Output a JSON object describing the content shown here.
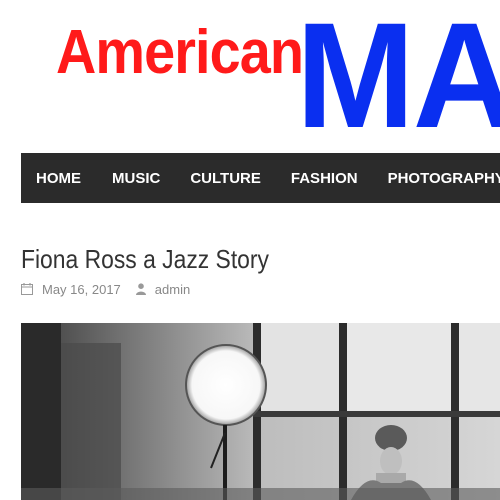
{
  "header": {
    "logo_part1": "American",
    "logo_part2": "MAG",
    "logo_part1_color": "#ff1a1a",
    "logo_part2_color": "#0a2ff0"
  },
  "nav": {
    "background": "#2b2b2b",
    "items": [
      {
        "label": "HOME"
      },
      {
        "label": "MUSIC"
      },
      {
        "label": "CULTURE"
      },
      {
        "label": "FASHION"
      },
      {
        "label": "PHOTOGRAPHY"
      }
    ]
  },
  "post": {
    "title": "Fiona Ross a Jazz Story",
    "date": "May 16, 2017",
    "author": "admin",
    "date_icon": "calendar-icon",
    "author_icon": "user-icon"
  },
  "featured_image": {
    "style": "black-and-white photograph"
  }
}
